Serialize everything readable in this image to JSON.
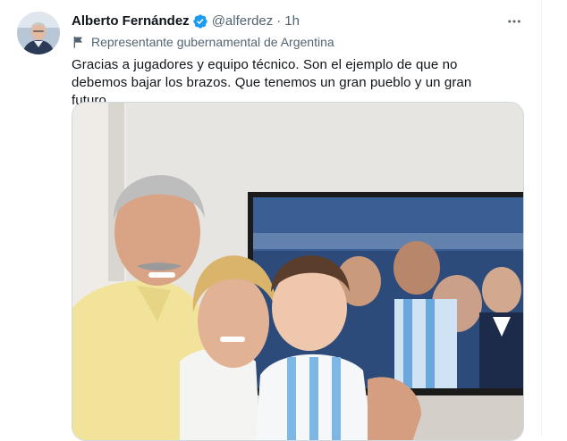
{
  "tweet": {
    "author_name": "Alberto Fernández",
    "handle": "@alferdez",
    "separator": "·",
    "time": "1h",
    "label": "Representante gubernamental de Argentina",
    "text": "Gracias a jugadores y equipo técnico. Son el ejemplo de que no debemos bajar los brazos. Que tenemos un gran pueblo y un gran futuro."
  },
  "icons": {
    "verified": "verified-badge-icon",
    "label": "government-flag-icon",
    "more": "more-dots-icon"
  },
  "colors": {
    "verified_blue": "#1d9bf0",
    "secondary_text": "#536471",
    "primary_text": "#0f1419",
    "border": "#cfd9de"
  }
}
